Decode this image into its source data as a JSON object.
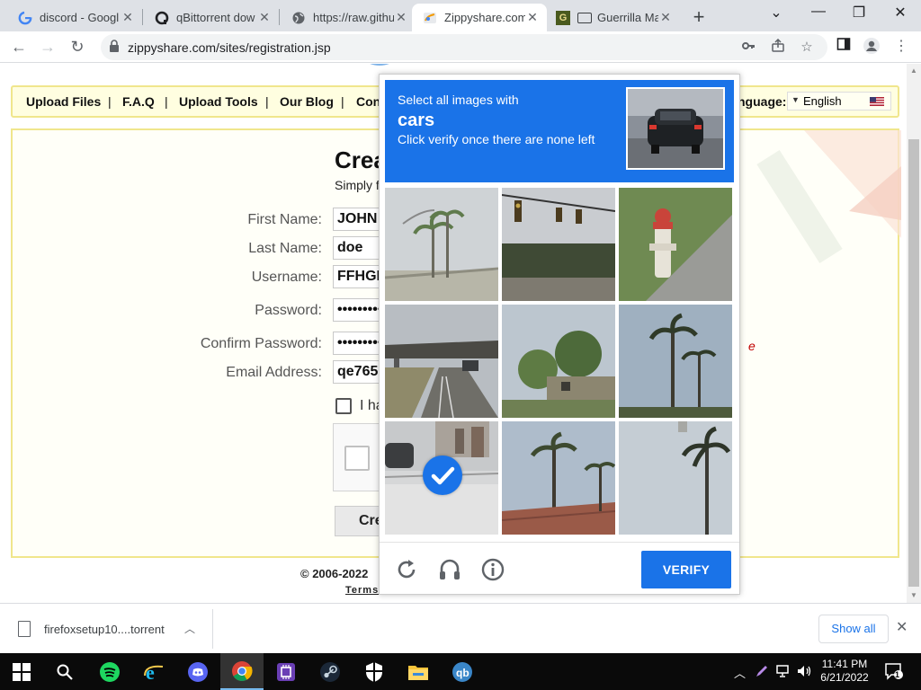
{
  "browser": {
    "tabs": [
      {
        "title": "discord - Googl",
        "icon": "google-g-icon",
        "active": false
      },
      {
        "title": "qBittorrent dow",
        "icon": "qbittorrent-icon",
        "active": false
      },
      {
        "title": "https://raw.githu",
        "icon": "globe-icon",
        "active": false
      },
      {
        "title": "Zippyshare.com",
        "icon": "zippyshare-icon",
        "active": true
      },
      {
        "title": "Guerrilla Ma",
        "icon": "guerrilla-icon",
        "active": false
      }
    ],
    "url": "zippyshare.com/sites/registration.jsp"
  },
  "site": {
    "nav": [
      "Upload Files",
      "F.A.Q",
      "Upload Tools",
      "Our Blog",
      "Con"
    ],
    "nav_sep": "|",
    "language_label": "nguage:",
    "language_value": "English",
    "form": {
      "title": "Crea",
      "subtitle": "Simply f",
      "fields": [
        {
          "label": "First Name:",
          "value": "JOHN"
        },
        {
          "label": "Last Name:",
          "value": "doe"
        },
        {
          "label": "Username:",
          "value": "FFHGF"
        },
        {
          "label": "Password:",
          "value": "••••••••••"
        },
        {
          "label": "Confirm Password:",
          "value": "••••••••••"
        },
        {
          "label": "Email Address:",
          "value": "qe765l"
        }
      ],
      "terms_text": "I ha",
      "create_button": "Cre",
      "side_error": "e"
    },
    "copyright": "© 2006-2022",
    "terms_link": "Terms"
  },
  "captcha": {
    "instruction_line1": "Select all images with",
    "target": "cars",
    "instruction_line2": "Click verify once there are none left",
    "tiles": [
      {
        "scene": "palm trees by road",
        "selected": false
      },
      {
        "scene": "traffic lights",
        "selected": false
      },
      {
        "scene": "fire hydrant",
        "selected": false
      },
      {
        "scene": "road under bridge",
        "selected": false
      },
      {
        "scene": "palm trees and house",
        "selected": false
      },
      {
        "scene": "palm trees",
        "selected": false
      },
      {
        "scene": "storefront with car",
        "selected": true
      },
      {
        "scene": "palm trees and roof",
        "selected": false
      },
      {
        "scene": "palm tree",
        "selected": false
      }
    ],
    "verify_label": "VERIFY"
  },
  "downloads": {
    "file_name": "firefoxsetup10....torrent",
    "show_all_label": "Show all"
  },
  "taskbar": {
    "time": "11:41 PM",
    "date": "6/21/2022",
    "notification_count": "1"
  },
  "colors": {
    "captcha_blue": "#1a73e8",
    "nav_bg": "#fffee0",
    "nav_border": "#f0e68c",
    "error_red": "#c00000"
  }
}
